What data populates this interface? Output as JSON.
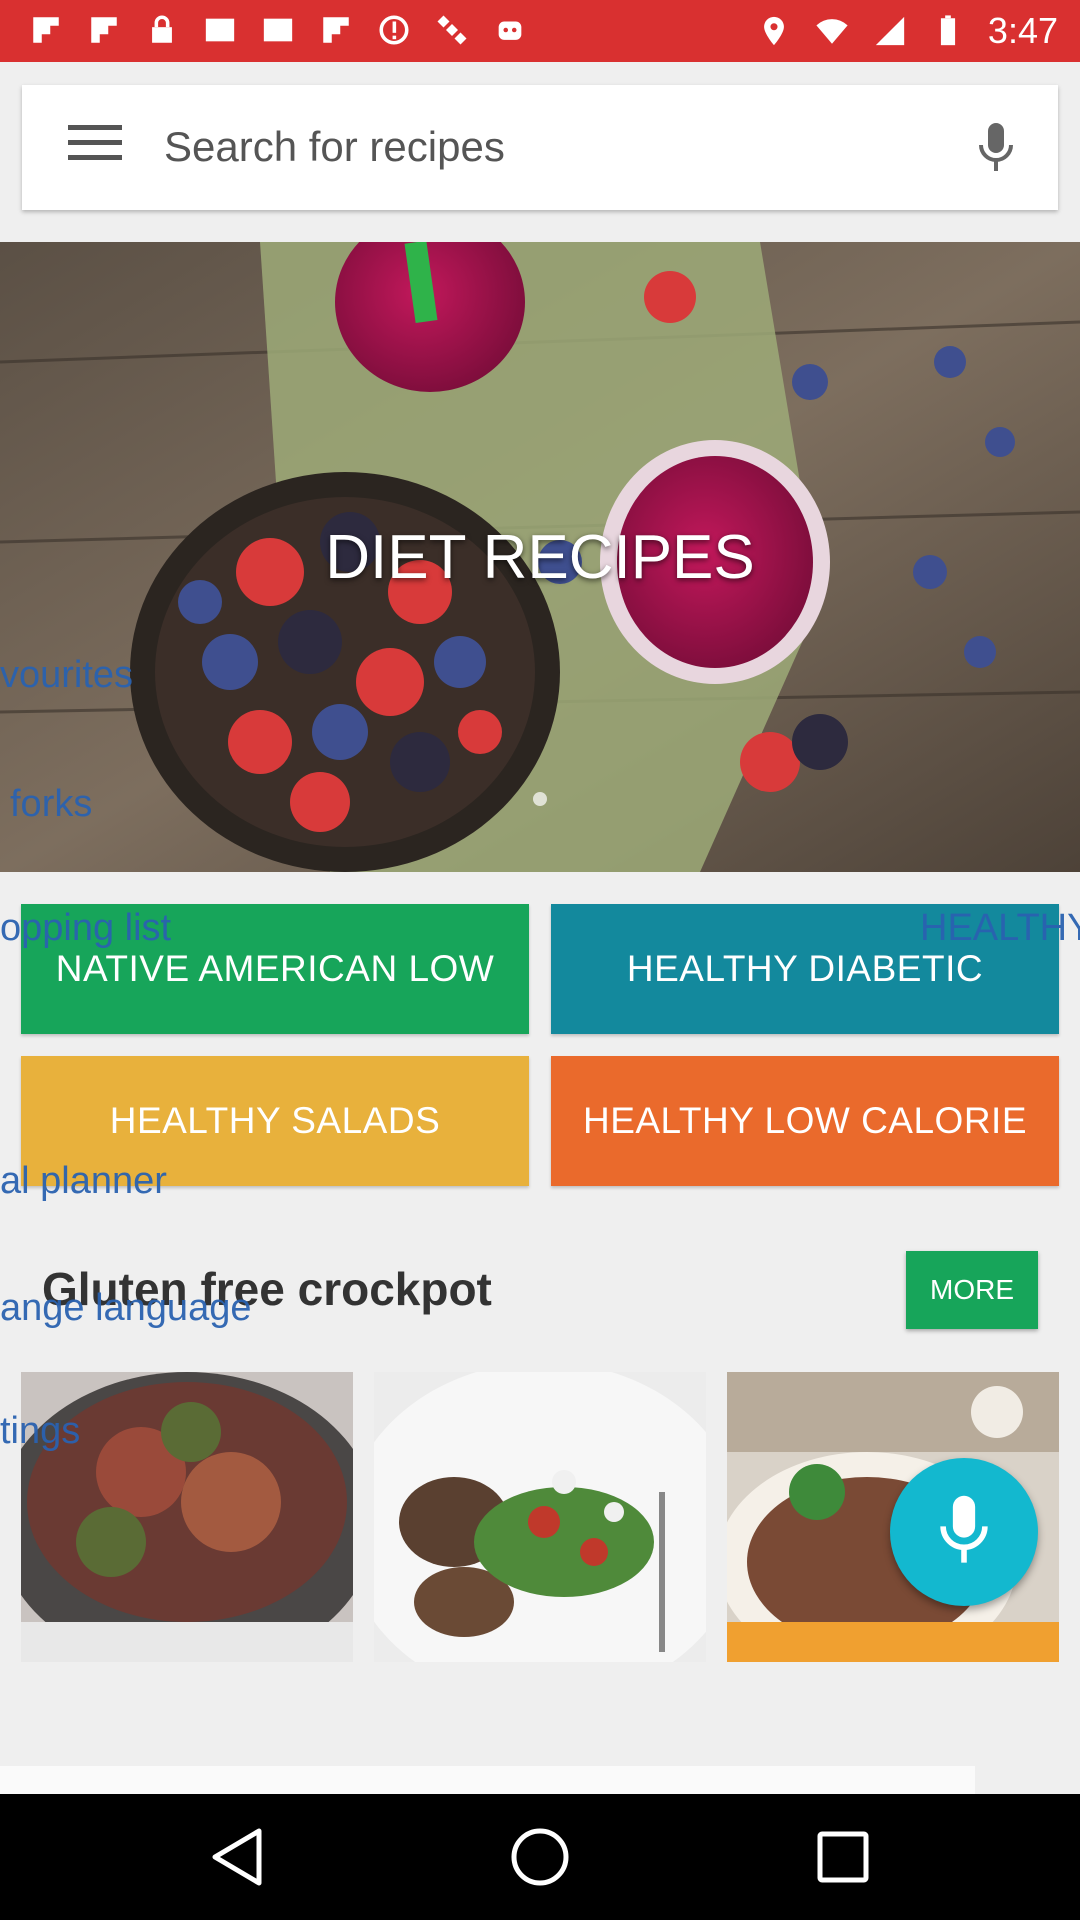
{
  "status_bar": {
    "time": "3:47",
    "bg_color": "#d93030",
    "left_icons": [
      "flipboard-icon",
      "flipboard-icon",
      "lock-icon",
      "image-icon",
      "image-icon",
      "flipboard-icon",
      "alert-icon",
      "satellite-icon",
      "app-icon"
    ],
    "right_icons": [
      "location-icon",
      "wifi-icon",
      "signal-icon",
      "battery-icon"
    ]
  },
  "search": {
    "placeholder": "Search for recipes",
    "menu_icon": "menu-icon",
    "mic_icon": "mic-icon"
  },
  "hero": {
    "title": "DIET RECIPES"
  },
  "drawer_ghost": {
    "favourites": "vourites",
    "forks": "forks",
    "shopping": "opping list",
    "healthy": "HEALTHY",
    "planner": "al planner",
    "language": "ange language",
    "settings": "tings"
  },
  "categories": [
    {
      "label": "NATIVE AMERICAN LOW",
      "color": "#17a55a"
    },
    {
      "label": "HEALTHY DIABETIC",
      "color": "#13899d"
    },
    {
      "label": "HEALTHY SALADS",
      "color": "#e8b13c"
    },
    {
      "label": "HEALTHY LOW CALORIE",
      "color": "#ea6a2c"
    }
  ],
  "section": {
    "title": "Gluten free crockpot",
    "more_label": "MORE"
  },
  "fab": {
    "icon": "mic-icon",
    "color": "#13b8cf"
  },
  "nav": {
    "icons": [
      "back-icon",
      "home-icon",
      "recents-icon"
    ]
  }
}
